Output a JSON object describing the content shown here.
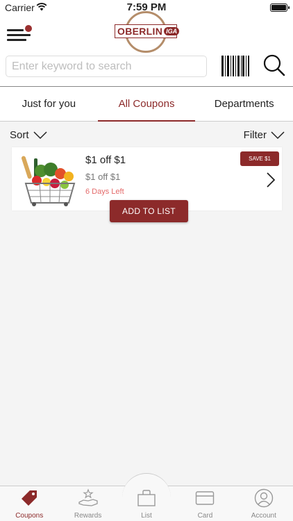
{
  "status_bar": {
    "carrier": "Carrier",
    "time": "7:59 PM"
  },
  "header": {
    "logo": {
      "name": "OBERLIN",
      "badge": "IGA"
    },
    "search": {
      "placeholder": "Enter keyword to search",
      "value": ""
    }
  },
  "tabs": [
    {
      "label": "Just for you",
      "active": false
    },
    {
      "label": "All Coupons",
      "active": true
    },
    {
      "label": "Departments",
      "active": false
    }
  ],
  "sort_label": "Sort",
  "filter_label": "Filter",
  "coupons": [
    {
      "title": "$1 off $1",
      "subtitle": "$1 off $1",
      "expires": "6 Days Left",
      "badge": "SAVE $1",
      "action_label": "ADD TO LIST"
    }
  ],
  "bottom_nav": [
    {
      "label": "Coupons",
      "icon": "tag-icon",
      "active": true
    },
    {
      "label": "Rewards",
      "icon": "rewards-hand-star-icon",
      "active": false
    },
    {
      "label": "List",
      "icon": "shopping-bag-icon",
      "active": false
    },
    {
      "label": "Card",
      "icon": "card-icon",
      "active": false
    },
    {
      "label": "Account",
      "icon": "account-user-icon",
      "active": false
    }
  ],
  "colors": {
    "accent": "#8c2a2a",
    "expiry": "#e46a6a",
    "logo_ring": "#b48d6a"
  }
}
